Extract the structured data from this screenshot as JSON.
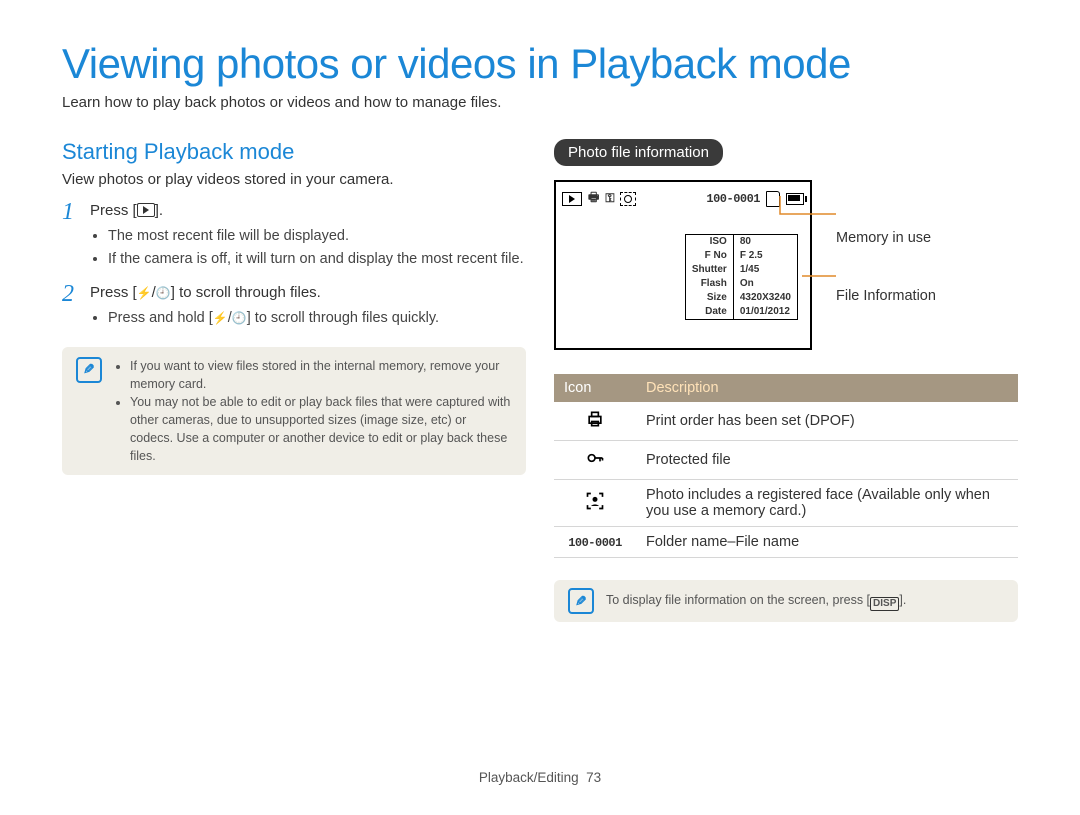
{
  "page_title": "Viewing photos or videos in Playback mode",
  "subtitle": "Learn how to play back photos or videos and how to manage files.",
  "left": {
    "section_title": "Starting Playback mode",
    "section_sub": "View photos or play videos stored in your camera.",
    "steps": [
      {
        "num": "1",
        "intro_pre": "Press [",
        "intro_post": "].",
        "bullets": [
          "The most recent file will be displayed.",
          "If the camera is off, it will turn on and display the most recent file."
        ]
      },
      {
        "num": "2",
        "intro_pre": "Press [",
        "intro_mid": "/",
        "intro_post": "] to scroll through files.",
        "bullets_rich": {
          "pre": "Press and hold [",
          "mid": "/",
          "post": "] to scroll through files quickly."
        }
      }
    ],
    "notes": [
      "If you want to view files stored in the internal memory, remove your memory card.",
      "You may not be able to edit or play back files that were captured with other cameras, due to unsupported sizes (image size, etc) or codecs. Use a computer or another device to edit or play back these files."
    ]
  },
  "right": {
    "pill": "Photo file information",
    "screen": {
      "folder_file": "100-0001",
      "info_rows": [
        {
          "k": "ISO",
          "v": "80"
        },
        {
          "k": "F No",
          "v": "F 2.5"
        },
        {
          "k": "Shutter",
          "v": "1/45"
        },
        {
          "k": "Flash",
          "v": "On"
        },
        {
          "k": "Size",
          "v": "4320X3240"
        },
        {
          "k": "Date",
          "v": "01/01/2012"
        }
      ]
    },
    "callout_memory": "Memory in use",
    "callout_fileinfo": "File Information",
    "table": {
      "head_icon": "Icon",
      "head_desc": "Description",
      "rows": {
        "printer": "Print order has been set (DPOF)",
        "key": "Protected file",
        "face": "Photo includes a registered face (Available only when you use a memory card.)",
        "counter_label": "100-0001",
        "counter": "Folder name–File name"
      }
    },
    "bottom_note_pre": "To display file information on the screen, press [",
    "bottom_note_disp": "DISP",
    "bottom_note_post": "]."
  },
  "footer_section": "Playback/Editing",
  "footer_page": "73"
}
